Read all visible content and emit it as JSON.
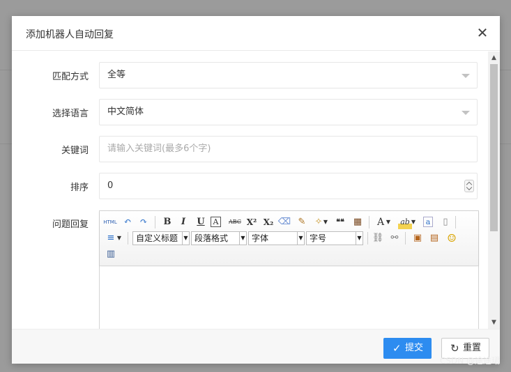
{
  "dialog": {
    "title": "添加机器人自动回复",
    "close_glyph": "✕"
  },
  "form": {
    "match_label": "匹配方式",
    "match_value": "全等",
    "language_label": "选择语言",
    "language_value": "中文简体",
    "keyword_label": "关键词",
    "keyword_placeholder": "请输入关键词(最多6个字)",
    "sort_label": "排序",
    "sort_value": "0",
    "reply_label": "问题回复"
  },
  "editor": {
    "toolbar_row1": {
      "html": "HTML",
      "undo": "↶",
      "redo": "↷",
      "bold": "B",
      "italic": "I",
      "underline": "U",
      "font_border": "A",
      "strikethrough": "ABC",
      "superscript": "X²",
      "subscript": "X₂",
      "eraser": "⌫",
      "format_brush": "✎",
      "magic": "✧",
      "quote": "❝❝",
      "paste_text": "▦",
      "font_color": "A",
      "highlight": "ab",
      "select_all": "a",
      "new_doc": "▯"
    },
    "toolbar_row2": {
      "line_height": "≡",
      "combo_heading": "自定义标题",
      "combo_paragraph": "段落格式",
      "combo_font": "字体",
      "combo_size": "字号",
      "link": "⛓",
      "unlink": "⚯",
      "image": "▣",
      "image_multi": "▤",
      "emotion": "☺",
      "video": "▥"
    }
  },
  "footer": {
    "submit_label": "提交",
    "submit_icon": "✓",
    "reset_label": "重置",
    "reset_icon": "↻"
  },
  "watermark": "CSDN @途途珺",
  "colors": {
    "primary": "#2d8cf0",
    "border": "#e6e6e6",
    "overlay": "#9b9b9b"
  }
}
